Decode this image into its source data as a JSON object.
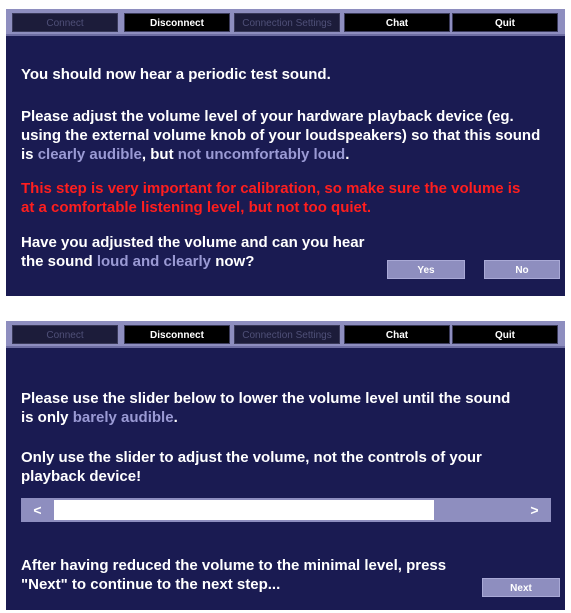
{
  "toolbar": {
    "connect": "Connect",
    "disconnect": "Disconnect",
    "connection_settings": "Connection Settings",
    "chat": "Chat",
    "quit": "Quit"
  },
  "step1": {
    "line1": "You should now hear a periodic test sound.",
    "p2_a": "Please adjust the volume level of your hardware playback device (eg. using the external volume knob of your loudspeakers) so that this sound is ",
    "p2_hl1": "clearly audible",
    "p2_b": ", but ",
    "p2_hl2": "not uncomfortably loud",
    "p2_c": ".",
    "warning": "This step is very important for calibration, so make sure the volume is at a comfortable listening level, but not too quiet.",
    "q_a": "Have you adjusted the volume and can you hear the sound ",
    "q_hl": "loud and clearly",
    "q_b": " now?",
    "yes_label": "Yes",
    "no_label": "No"
  },
  "step2": {
    "p1_a": "Please use the slider below to lower the volume level until the sound is only ",
    "p1_hl": "barely audible",
    "p1_b": ".",
    "p2": "Only use the slider to adjust the volume, not the controls of your playback device!",
    "slider_left": "<",
    "slider_right": ">",
    "slider_level": 0.82,
    "p3": "After having reduced the volume to the minimal level, press \"Next\" to continue to the next step...",
    "next_label": "Next"
  },
  "colors": {
    "panel_bg": "#1a1b52",
    "toolbar_bg": "#8e8ebf",
    "highlight": "#9a9ad4",
    "warning": "#ff1e1e"
  }
}
